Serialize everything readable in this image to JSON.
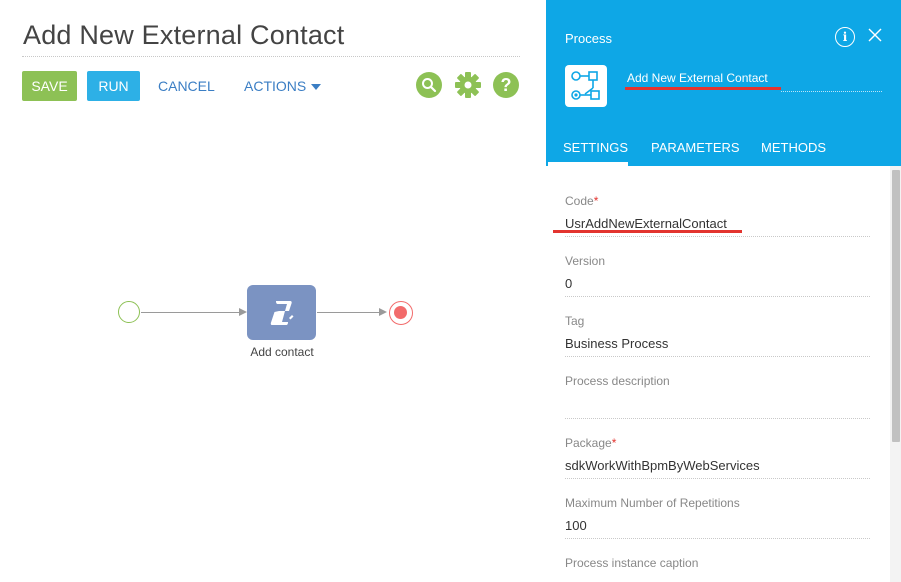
{
  "page": {
    "title": "Add New External Contact"
  },
  "toolbar": {
    "save_label": "SAVE",
    "run_label": "RUN",
    "cancel_label": "CANCEL",
    "actions_label": "ACTIONS",
    "icons": [
      "search-icon",
      "gear-icon",
      "help-icon"
    ],
    "accent_green": "#8dc155",
    "accent_blue": "#2db0e6"
  },
  "diagram": {
    "task_label": "Add contact",
    "task_color": "#7b93c2",
    "start_color": "#8dc155",
    "end_color": "#f26b6b"
  },
  "panel": {
    "header_label": "Process",
    "process_name": "Add New External Contact",
    "header_color": "#0ea7e6",
    "tabs": [
      {
        "label": "SETTINGS",
        "active": true
      },
      {
        "label": "PARAMETERS",
        "active": false
      },
      {
        "label": "METHODS",
        "active": false
      }
    ],
    "fields": [
      {
        "label": "Code",
        "required": true,
        "value": "UsrAddNewExternalContact"
      },
      {
        "label": "Version",
        "required": false,
        "value": "0"
      },
      {
        "label": "Tag",
        "required": false,
        "value": "Business Process"
      },
      {
        "label": "Process description",
        "required": false,
        "value": ""
      },
      {
        "label": "Package",
        "required": true,
        "value": "sdkWorkWithBpmByWebServices"
      },
      {
        "label": "Maximum Number of Repetitions",
        "required": false,
        "value": "100"
      },
      {
        "label": "Process instance caption",
        "required": false,
        "value": ""
      }
    ]
  }
}
